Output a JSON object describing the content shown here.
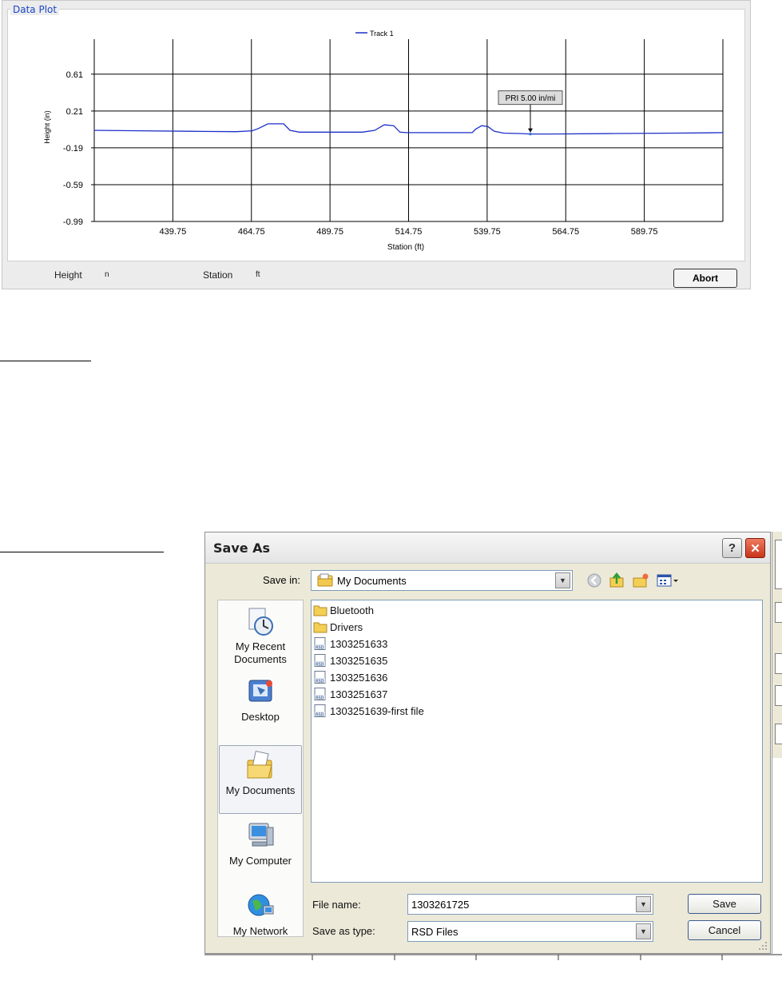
{
  "plot_panel": {
    "title": "Data Plot",
    "status": {
      "height_label": "Height",
      "height_unit": "n",
      "station_label": "Station",
      "station_unit": "ft"
    },
    "abort_label": "Abort"
  },
  "chart_data": {
    "type": "line",
    "legend": [
      "Track 1"
    ],
    "legend_placement": "top-center",
    "xlabel": "Station (ft)",
    "ylabel": "Height (in)",
    "grid": true,
    "xlim": [
      414.75,
      614.75
    ],
    "ylim": [
      -0.99,
      0.99
    ],
    "x_ticks": [
      439.75,
      464.75,
      489.75,
      514.75,
      539.75,
      564.75,
      589.75
    ],
    "x_tick_labels": [
      "439.75",
      "464.75",
      "489.75",
      "514.75",
      "539.75",
      "564.75",
      "589.75"
    ],
    "y_ticks": [
      0.61,
      0.21,
      -0.19,
      -0.59,
      -0.99
    ],
    "y_tick_labels": [
      "0.61",
      "0.21",
      "-0.19",
      "-0.59",
      "-0.99"
    ],
    "series": [
      {
        "name": "Track 1",
        "color": "#1c2fc8",
        "x": [
          414.75,
          430,
          445,
          460,
          465,
          467,
          470,
          475,
          477,
          480,
          490,
          500,
          504,
          507,
          510,
          512,
          514,
          525,
          535,
          536,
          538,
          540,
          542,
          545,
          550,
          553.5,
          560,
          580,
          600,
          614.75
        ],
        "y": [
          0.0,
          -0.005,
          -0.01,
          -0.015,
          -0.005,
          0.02,
          0.07,
          0.07,
          0.0,
          -0.02,
          -0.02,
          -0.02,
          0.0,
          0.06,
          0.05,
          -0.02,
          -0.025,
          -0.025,
          -0.025,
          0.01,
          0.05,
          0.04,
          -0.01,
          -0.03,
          -0.035,
          -0.04,
          -0.04,
          -0.035,
          -0.03,
          -0.025
        ]
      }
    ],
    "annotations": [
      {
        "text": "PRI 5.00 in/mi",
        "x": 553.5,
        "y": -0.04
      }
    ]
  },
  "dialog": {
    "title": "Save As",
    "save_in_label": "Save in:",
    "save_in_value": "My Documents",
    "places": [
      "My Recent Documents",
      "Desktop",
      "My Documents",
      "My Computer",
      "My Network"
    ],
    "selected_place": "My Documents",
    "files": [
      {
        "name": "Bluetooth",
        "icon": "folder-icon"
      },
      {
        "name": "Drivers",
        "icon": "folder-icon"
      },
      {
        "name": "1303251633",
        "icon": "rsd-file-icon"
      },
      {
        "name": "1303251635",
        "icon": "rsd-file-icon"
      },
      {
        "name": "1303251636",
        "icon": "rsd-file-icon"
      },
      {
        "name": "1303251637",
        "icon": "rsd-file-icon"
      },
      {
        "name": "1303251639-first file",
        "icon": "rsd-file-icon"
      }
    ],
    "file_name_label": "File name:",
    "file_name_value": "1303261725",
    "save_as_type_label": "Save as type:",
    "save_as_type_value": "RSD Files",
    "save_label": "Save",
    "cancel_label": "Cancel"
  }
}
